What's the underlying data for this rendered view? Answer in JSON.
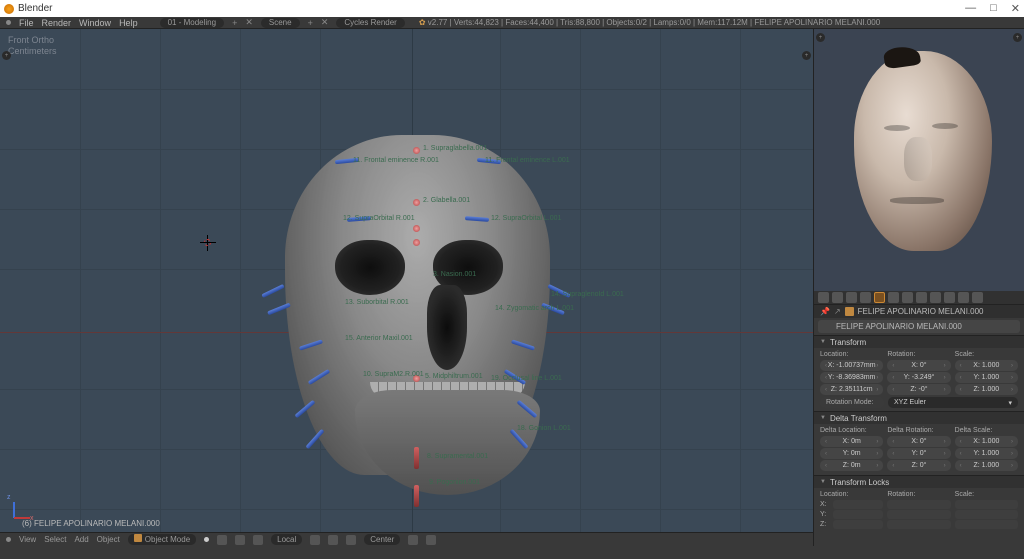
{
  "app": {
    "title": "Blender",
    "window_icon": "blender-icon"
  },
  "window_controls": {
    "min": "—",
    "max": "□",
    "close": "✕"
  },
  "menus": [
    "File",
    "Render",
    "Window",
    "Help"
  ],
  "layout_dropdown": "01 - Modeling",
  "scene_dropdown": "Scene",
  "engine_dropdown": "Cycles Render",
  "header_stats": "v2.77 | Verts:44,823 | Faces:44,400 | Tris:88,800 | Objects:0/2 | Lamps:0/0 | Mem:117.12M | FELIPE APOLINARIO MELANI.000",
  "view3d": {
    "top_left_line1": "Front Ortho",
    "top_left_line2": "Centimeters",
    "selected_info": "(6) FELIPE APOLINARIO MELANI.000",
    "footer": {
      "menus": [
        "View",
        "Select",
        "Add",
        "Object"
      ],
      "mode": "Object Mode",
      "orientation": "Local",
      "pivot": "Center"
    },
    "labels": [
      "1. Supraglabella.001",
      "11. Frontal eminence R.001",
      "11. Frontal eminence L.001",
      "2. Glabella.001",
      "12. SupraOrbital R.001",
      "12. SupraOrbital L.001",
      "3. Nasion.001",
      "13. Suborbital R.001",
      "14. Zygomatic arch L.001",
      "14. SupraglenoId L.001",
      "15. Anterior Maxil.001",
      "5. Midphiltrum.001",
      "10. SupraM2.R.001",
      "19. Occlusal line L.001",
      "18. Gonion L.001",
      "8. Supramental.001",
      "9. Pogonion.001"
    ]
  },
  "properties": {
    "object_name": "FELIPE APOLINARIO MELANI.000",
    "breadcrumb": "FELIPE APOLINARIO MELANI.000",
    "panels": {
      "transform": {
        "title": "Transform",
        "location_label": "Location:",
        "rotation_label": "Rotation:",
        "scale_label": "Scale:",
        "loc": {
          "x": "X: -1.00737mm",
          "y": "Y: -8.36983mm",
          "z": "Z:  2.35111cm"
        },
        "rot": {
          "x": "X:          0°",
          "y": "Y:     -3.249°",
          "z": "Z:         -0°"
        },
        "scl": {
          "x": "X:      1.000",
          "y": "Y:      1.000",
          "z": "Z:      1.000"
        },
        "rotation_mode_label": "Rotation Mode:",
        "rotation_mode_value": "XYZ Euler"
      },
      "delta": {
        "title": "Delta Transform",
        "loc_label": "Delta Location:",
        "rot_label": "Delta Rotation:",
        "scl_label": "Delta Scale:",
        "loc": {
          "x": "X:          0m",
          "y": "Y:          0m",
          "z": "Z:          0m"
        },
        "rot": {
          "x": "X:          0°",
          "y": "Y:          0°",
          "z": "Z:          0°"
        },
        "scl": {
          "x": "X:      1.000",
          "y": "Y:      1.000",
          "z": "Z:      1.000"
        }
      },
      "locks": {
        "title": "Transform Locks",
        "location_label": "Location:",
        "rotation_label": "Rotation:",
        "scale_label": "Scale:",
        "axes": [
          "X:",
          "Y:",
          "Z:"
        ]
      }
    }
  }
}
